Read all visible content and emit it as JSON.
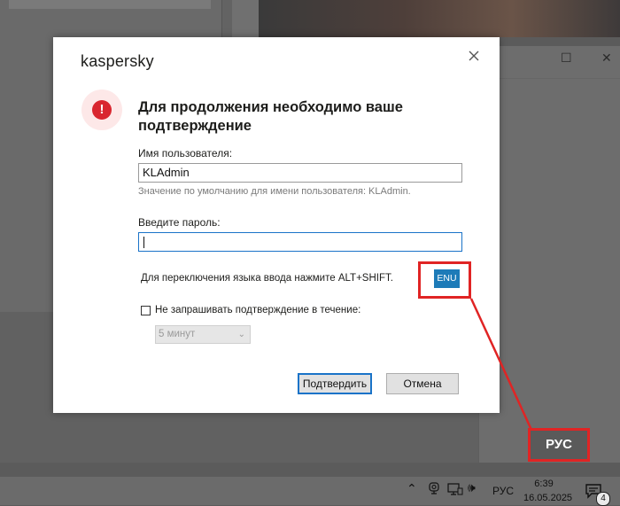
{
  "dialog": {
    "brand": "kaspersky",
    "heading": "Для продолжения необходимо ваше подтверждение",
    "username_label": "Имя пользователя:",
    "username_value": "KLAdmin",
    "username_hint": "Значение по умолчанию для имени пользователя: KLAdmin.",
    "password_label": "Введите пароль:",
    "password_value": "",
    "language_hint": "Для переключения языка ввода нажмите ALT+SHIFT.",
    "input_language": "ENU",
    "remember_label": "Не запрашивать подтверждение в течение:",
    "remember_checked": false,
    "remember_duration": "5 минут",
    "confirm_label": "Подтвердить",
    "cancel_label": "Отмена"
  },
  "annotation": {
    "label": "РУС",
    "color": "#e02424"
  },
  "taskbar": {
    "language": "РУС",
    "time": "6:39",
    "date": "16.05.2025",
    "notification_count": "4"
  },
  "colors": {
    "accent": "#1a73c8",
    "enu_badge": "#1d7bb8",
    "warning": "#d9262f"
  }
}
